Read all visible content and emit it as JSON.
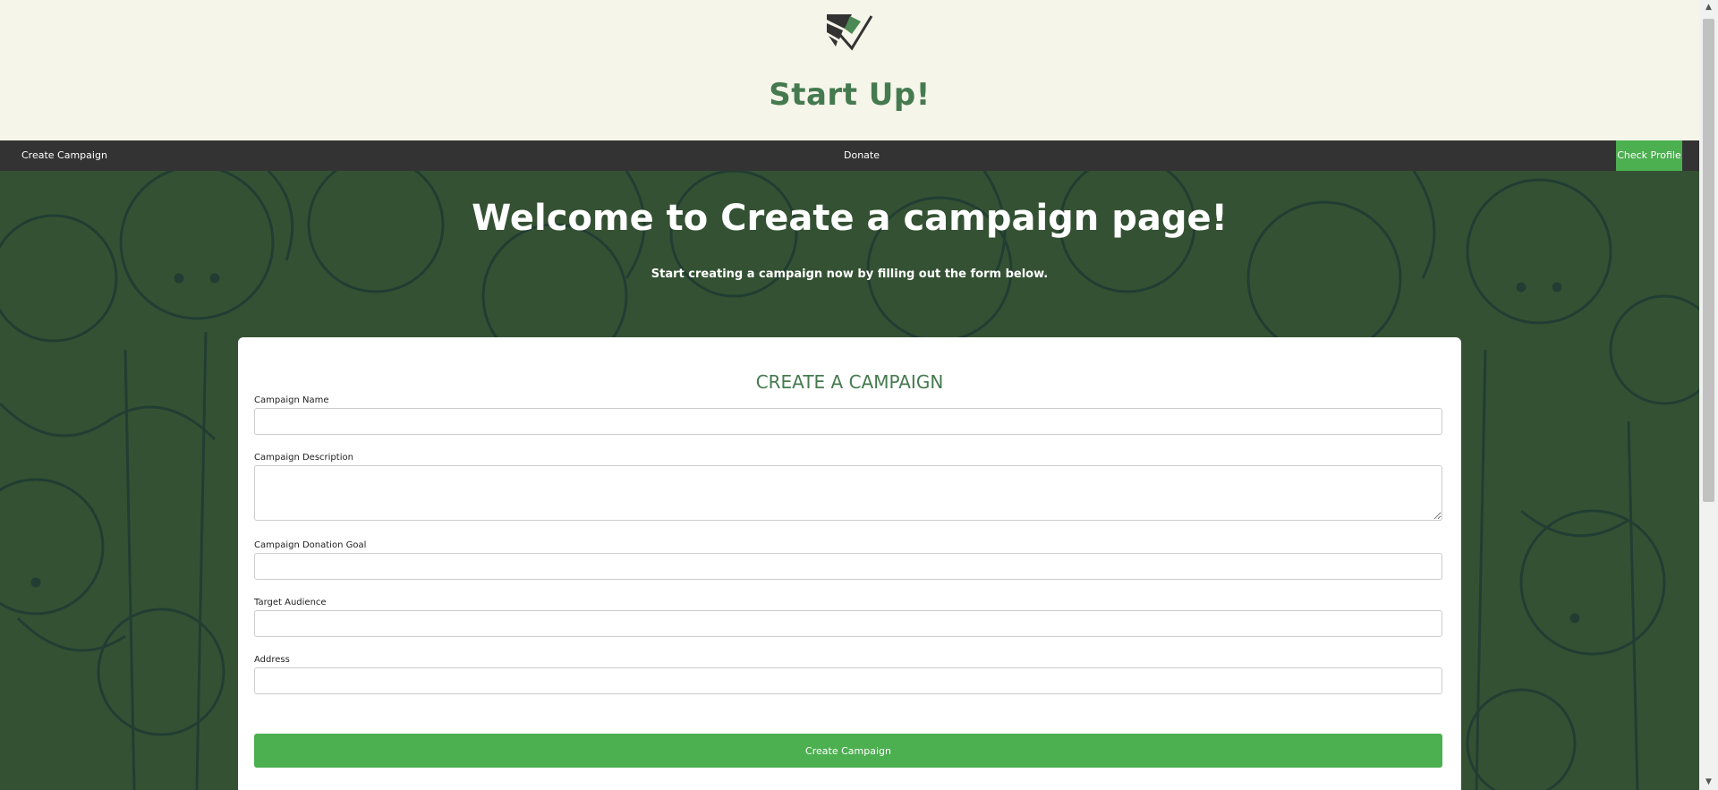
{
  "header": {
    "title": "Start Up!"
  },
  "nav": {
    "create_campaign": "Create Campaign",
    "donate": "Donate",
    "check_profile": "Check Profile"
  },
  "hero": {
    "title": "Welcome to Create a campaign page!",
    "subtitle": "Start creating a campaign now by filling out the form below."
  },
  "form": {
    "title": "CREATE A CAMPAIGN",
    "fields": [
      {
        "label": "Campaign Name",
        "value": ""
      },
      {
        "label": "Campaign Description",
        "value": ""
      },
      {
        "label": "Campaign Donation Goal",
        "value": ""
      },
      {
        "label": "Target Audience",
        "value": ""
      },
      {
        "label": "Address",
        "value": ""
      }
    ],
    "submit_label": "Create Campaign"
  },
  "colors": {
    "accent": "#4caf50",
    "title_green": "#457a4f",
    "hero_bg": "#345233",
    "nav_bg": "#333333",
    "header_bg": "#f5f5e9"
  },
  "icons": {
    "logo": "checkmark-logo-icon",
    "scroll_up": "scroll-up-arrow-icon",
    "scroll_down": "scroll-down-arrow-icon"
  }
}
